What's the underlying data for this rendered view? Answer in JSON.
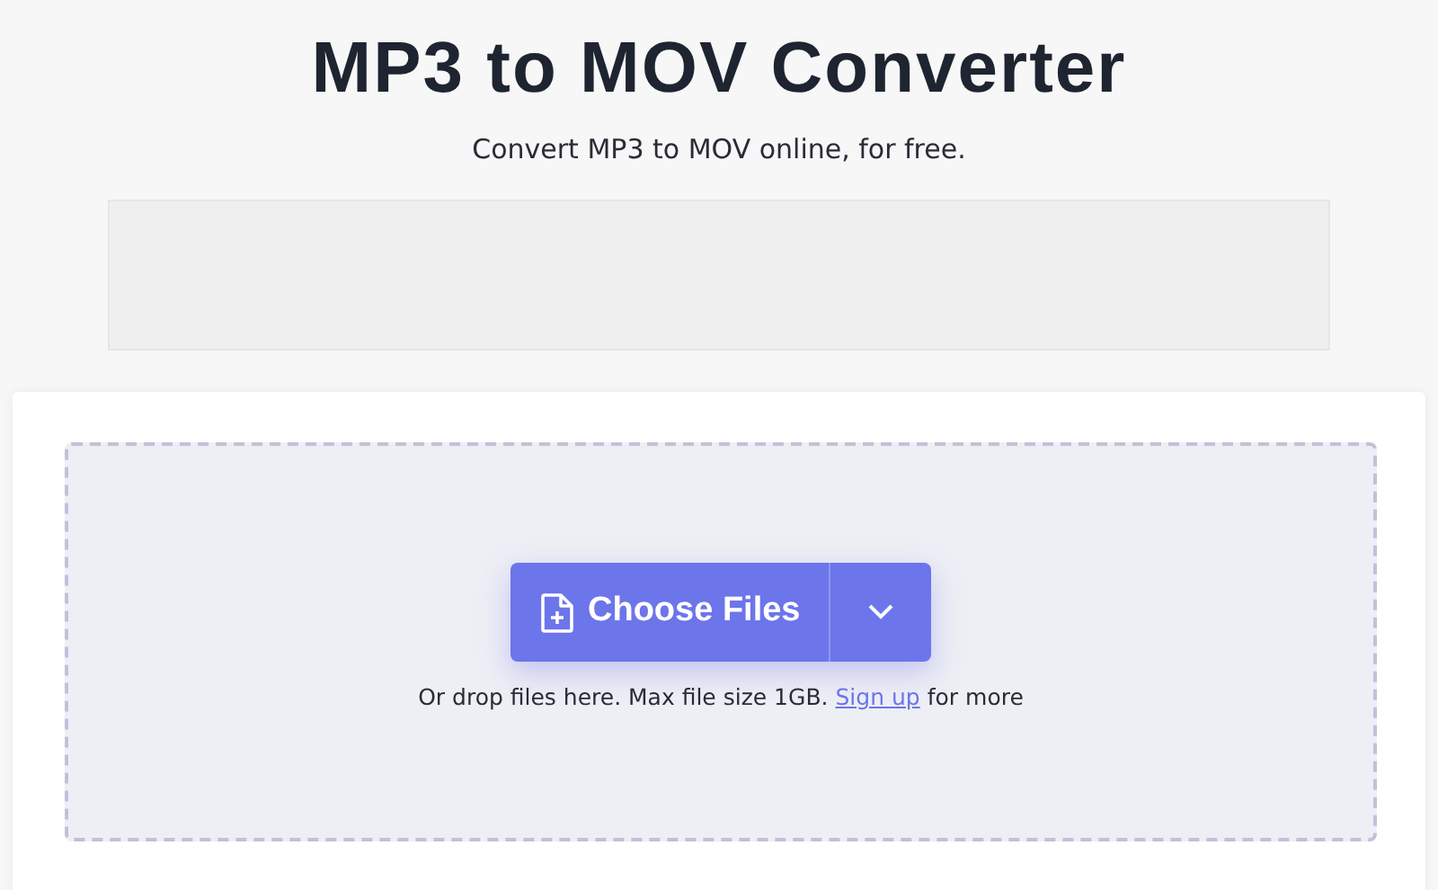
{
  "header": {
    "title": "MP3 to MOV Converter",
    "subtitle": "Convert MP3 to MOV online, for free."
  },
  "uploader": {
    "button_label": "Choose Files",
    "hint": "Or drop files here. Max file size 1GB.",
    "link": "Sign up",
    "hint_end": "for more"
  }
}
